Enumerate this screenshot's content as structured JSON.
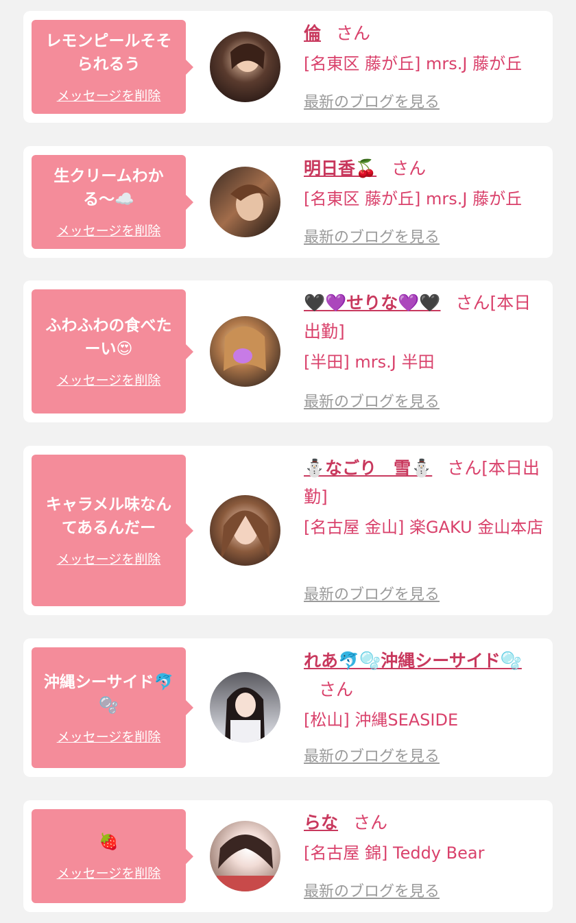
{
  "cards": [
    {
      "message": "レモンピールそそられるう",
      "delete_label": "メッセージを削除",
      "name": "倫",
      "suffix": "さん",
      "shop": "[名東区 藤が丘] mrs.J 藤が丘",
      "blog_label": "最新のブログを見る"
    },
    {
      "message": "生クリームわかる〜☁️",
      "delete_label": "メッセージを削除",
      "name": "明日香🍒",
      "suffix": "さん",
      "shop": "[名東区 藤が丘] mrs.J 藤が丘",
      "blog_label": "最新のブログを見る"
    },
    {
      "message": "ふわふわの食べたーい😍",
      "delete_label": "メッセージを削除",
      "name": "🖤💜せりな💜🖤",
      "suffix": "さん[本日出勤]",
      "shop": "[半田] mrs.J 半田",
      "blog_label": "最新のブログを見る"
    },
    {
      "message": "キャラメル味なんてあるんだー",
      "delete_label": "メッセージを削除",
      "name": "⛄なごり　雪⛄",
      "suffix": "さん[本日出勤]",
      "shop": "[名古屋 金山] 楽GAKU 金山本店",
      "blog_label": "最新のブログを見る"
    },
    {
      "message": "沖縄シーサイド🐬🫧",
      "delete_label": "メッセージを削除",
      "name": "れあ🐬🫧沖縄シーサイド🫧",
      "suffix": "さん",
      "shop": "[松山] 沖縄SEASIDE",
      "blog_label": "最新のブログを見る"
    },
    {
      "message": "🍓",
      "delete_label": "メッセージを削除",
      "name": "らな",
      "suffix": "さん",
      "shop": "[名古屋 錦] Teddy Bear",
      "blog_label": "最新のブログを見る"
    }
  ],
  "colors": {
    "bubble": "#f48c9a",
    "accent": "#d9416b",
    "link_gray": "#9a9a9a",
    "background": "#f2f2f2"
  }
}
